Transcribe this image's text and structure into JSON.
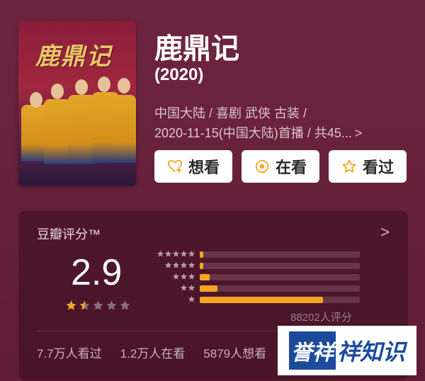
{
  "movie": {
    "poster_title": "鹿鼎记",
    "title": "鹿鼎记",
    "year": "(2020)",
    "meta_line1": "中国大陆 / 喜剧 武侠 古装 /",
    "meta_line2": "2020-11-15(中国大陆)首播 / 共45...",
    "meta_more": ">"
  },
  "actions": {
    "want_label": "想看",
    "watching_label": "在看",
    "watched_label": "看过"
  },
  "rating": {
    "label": "豆瓣评分™",
    "more": ">",
    "score": "2.9",
    "stars_filled": 1.5,
    "distribution": [
      {
        "stars": 5,
        "fraction": 0.02
      },
      {
        "stars": 4,
        "fraction": 0.02
      },
      {
        "stars": 3,
        "fraction": 0.06
      },
      {
        "stars": 2,
        "fraction": 0.11
      },
      {
        "stars": 1,
        "fraction": 0.77
      }
    ],
    "count": "88202人评分"
  },
  "stats": {
    "watched": "7.7万人看过",
    "watching": "1.2万人在看",
    "want": "5879人想看"
  },
  "watermark": {
    "logo": "誉祥",
    "text": "祥知识"
  },
  "colors": {
    "background": "#6a2238",
    "accent": "#f5a623",
    "button_bg": "#ffffff"
  }
}
